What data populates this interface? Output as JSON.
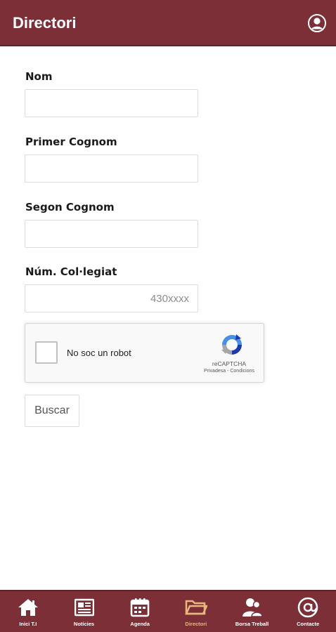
{
  "header": {
    "title": "Directori",
    "user_icon": "user-circle-icon"
  },
  "form": {
    "fields": [
      {
        "label": "Nom",
        "value": "",
        "placeholder": ""
      },
      {
        "label": "Primer Cognom",
        "value": "",
        "placeholder": ""
      },
      {
        "label": "Segon Cognom",
        "value": "",
        "placeholder": ""
      },
      {
        "label": "Núm. Col·legiat",
        "value": "",
        "placeholder": "430xxxx"
      }
    ],
    "captcha": {
      "label": "No soc un robot",
      "brand": "reCAPTCHA",
      "links": "Privadesa - Condicions",
      "checked": false
    },
    "search_button": "Buscar"
  },
  "tabbar": {
    "active_color": "#e7b77d",
    "bar_color": "#7d2f38",
    "items": [
      {
        "label": "Inici T.I",
        "icon": "home-icon",
        "active": false
      },
      {
        "label": "Notícies",
        "icon": "newspaper-icon",
        "active": false
      },
      {
        "label": "Agenda",
        "icon": "calendar-icon",
        "active": false
      },
      {
        "label": "Directori",
        "icon": "folder-icon",
        "active": true
      },
      {
        "label": "Borsa Treball",
        "icon": "people-icon",
        "active": false
      },
      {
        "label": "Contacte",
        "icon": "at-icon",
        "active": false
      }
    ]
  }
}
